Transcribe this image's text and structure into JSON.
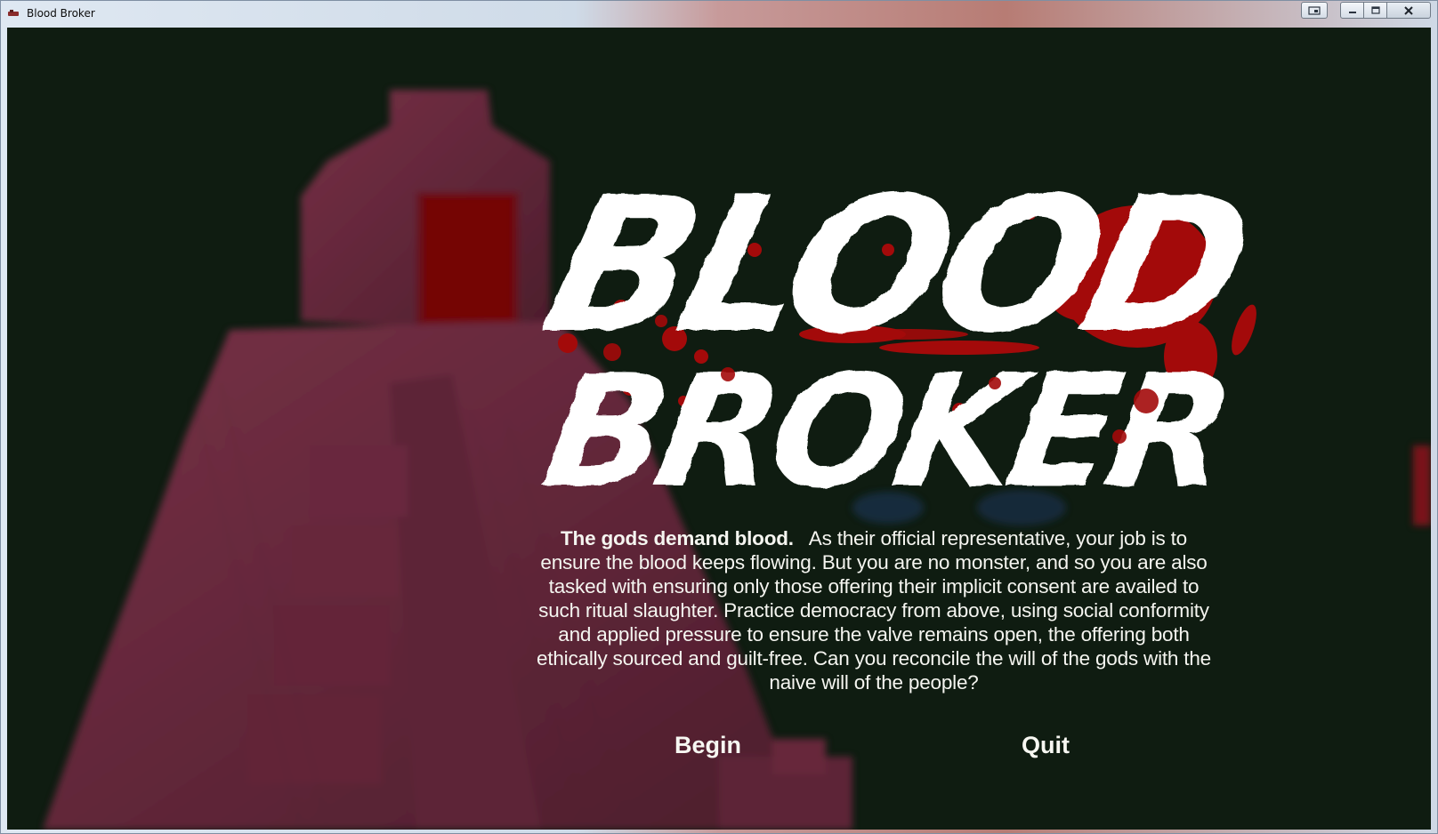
{
  "window": {
    "title": "Blood Broker",
    "controls": {
      "minimize_icon": "minimize-icon",
      "maximize_icon": "maximize-icon",
      "close_icon": "close-icon",
      "extra_icon": "window-switch-icon"
    }
  },
  "game": {
    "logo_line1": "BLOOD",
    "logo_line2": "BROKER",
    "description_lead": "The gods demand blood.",
    "description_body": "As their official representative, your job is to ensure the blood keeps flowing.  But you are no monster, and so you are also tasked with ensuring only those offering their implicit consent are availed to such ritual slaughter.  Practice democracy from above, using social conformity and applied pressure to ensure the valve remains open, the offering both ethically sourced and guilt-free.  Can you reconcile the will of the gods with the naive will of the people?",
    "begin_label": "Begin",
    "quit_label": "Quit"
  },
  "colors": {
    "background": "#0f1d12",
    "temple": "#7a2a45",
    "blood": "#a30a0a",
    "text": "#f5f5f0"
  }
}
